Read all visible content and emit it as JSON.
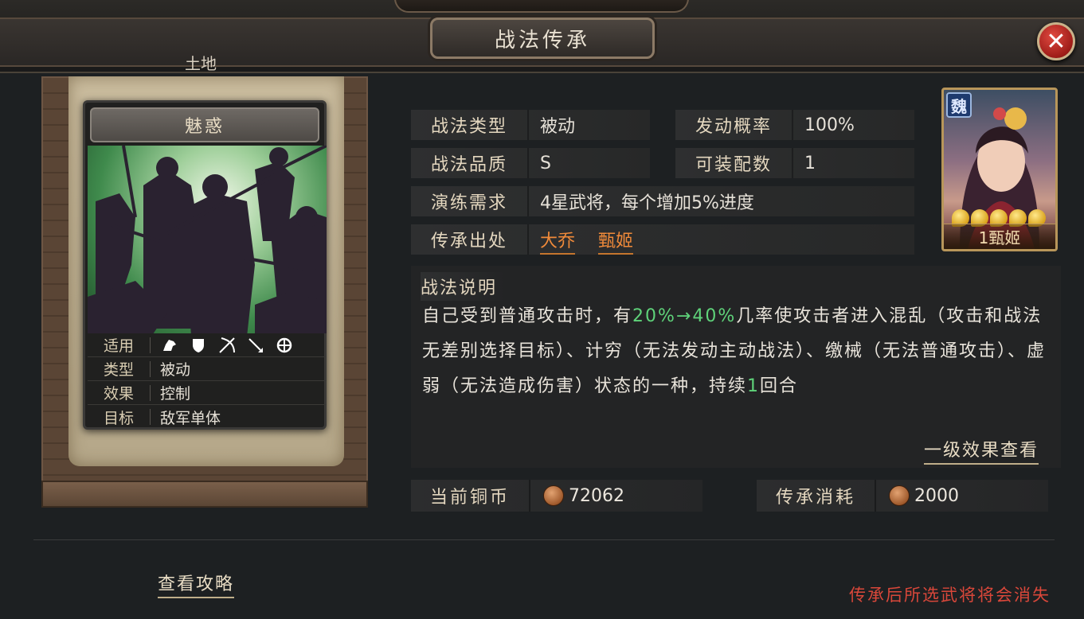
{
  "header": {
    "title": "战法传承",
    "land_label": "土地",
    "close_symbol": "✕"
  },
  "skill_card": {
    "name": "魅惑",
    "applicable_label": "适用",
    "troop_icons": [
      "cavalry-icon",
      "shield-icon",
      "archer-icon",
      "spear-icon",
      "siege-icon"
    ],
    "attributes": [
      {
        "label": "类型",
        "value": "被动"
      },
      {
        "label": "效果",
        "value": "控制"
      },
      {
        "label": "目标",
        "value": "敌军单体"
      }
    ]
  },
  "info": {
    "type_label": "战法类型",
    "type_value": "被动",
    "trigger_label": "发动概率",
    "trigger_value": "100%",
    "quality_label": "战法品质",
    "quality_value": "S",
    "slots_label": "可装配数",
    "slots_value": "1",
    "drill_label": "演练需求",
    "drill_value": "4星武将，每个增加5%进度",
    "source_label": "传承出处",
    "sources": [
      "大乔",
      "甄姬"
    ]
  },
  "portrait": {
    "faction": "魏",
    "name": "1甄姬",
    "stars": 5
  },
  "description": {
    "title": "战法说明",
    "text_part1": "自己受到普通攻击时，有",
    "highlight1": "20%→40%",
    "text_part2": "几率使攻击者进入混乱（攻击和战法无差别选择目标）、计穷（无法发动主动战法）、缴械（无法普通攻击）、虚弱（无法造成伤害）状态的一种，持续",
    "highlight2": "1",
    "text_part3": "回合",
    "effect_link": "一级效果查看"
  },
  "costs": {
    "current_label": "当前铜币",
    "current_value": "72062",
    "consume_label": "传承消耗",
    "consume_value": "2000"
  },
  "footer": {
    "guide_link": "查看攻略",
    "warning": "传承后所选武将将会消失"
  },
  "colors": {
    "accent_orange": "#f08a3a",
    "highlight_green": "#5fd37a",
    "warning_red": "#d9473a"
  }
}
